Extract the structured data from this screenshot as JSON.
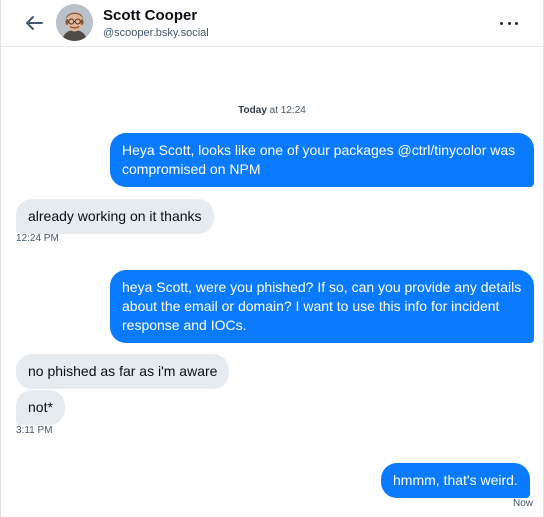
{
  "header": {
    "name": "Scott Cooper",
    "handle": "@scooper.bsky.social"
  },
  "day_separator": {
    "day": "Today",
    "time": "at 12:24"
  },
  "messages": [
    {
      "text": "Heya Scott, looks like one of your packages @ctrl/tinycolor was compromised on NPM"
    },
    {
      "text": "already working on it thanks",
      "meta": "12:24 PM"
    },
    {
      "text": "heya Scott, were you phished?  If so, can you provide any details about the email or domain?  I want to use this info for incident response and IOCs."
    },
    {
      "text": "no phished as far as i'm aware"
    },
    {
      "text": "not*",
      "meta": "3:11 PM"
    },
    {
      "text": "hmmm, that's weird.",
      "meta": "Now"
    }
  ],
  "colors": {
    "outgoing_bubble": "#0a7aff",
    "incoming_bubble": "#e6ebef",
    "secondary_text": "#42576c"
  },
  "icons": {
    "back": "arrow-left-icon",
    "more": "ellipsis-icon"
  }
}
